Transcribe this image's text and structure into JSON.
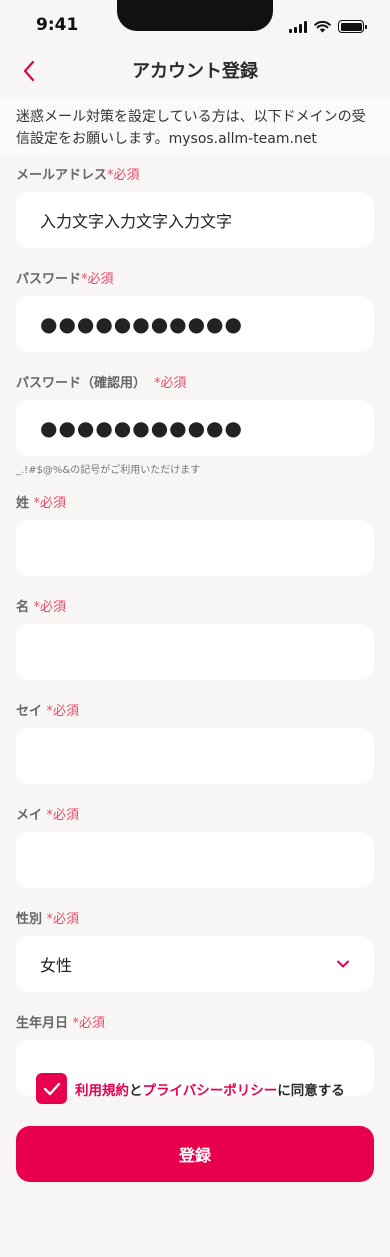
{
  "status_bar": {
    "time": "9:41"
  },
  "header": {
    "title": "アカウント登録"
  },
  "notice": "迷惑メール対策を設定している方は、以下ドメインの受信設定をお願いします。mysos.allm-team.net",
  "required_mark": "*必須",
  "fields": {
    "email": {
      "label": "メールアドレス",
      "value": "入力文字入力文字入力文字"
    },
    "password": {
      "label": "パスワード",
      "value": "●●●●●●●●●●●"
    },
    "password_confirm": {
      "label": "パスワード（確認用）",
      "value": "●●●●●●●●●●●",
      "hint": "_.!#$@%&の記号がご利用いただけます"
    },
    "last_name": {
      "label": "姓",
      "value": ""
    },
    "first_name": {
      "label": "名",
      "value": ""
    },
    "last_name_kana": {
      "label": "セイ",
      "value": ""
    },
    "first_name_kana": {
      "label": "メイ",
      "value": ""
    },
    "gender": {
      "label": "性別",
      "value": "女性"
    },
    "birthday": {
      "label": "生年月日",
      "value": ""
    }
  },
  "agreement": {
    "terms": "利用規約",
    "and": "と",
    "privacy": "プライバシーポリシー",
    "suffix": "に同意する",
    "checked": true
  },
  "submit_label": "登録",
  "colors": {
    "accent": "#e8004f",
    "required": "#e64a6b",
    "background": "#f8f6f4"
  },
  "icons": {
    "back": "chevron-left-icon",
    "dropdown": "chevron-down-icon",
    "check": "check-icon"
  }
}
